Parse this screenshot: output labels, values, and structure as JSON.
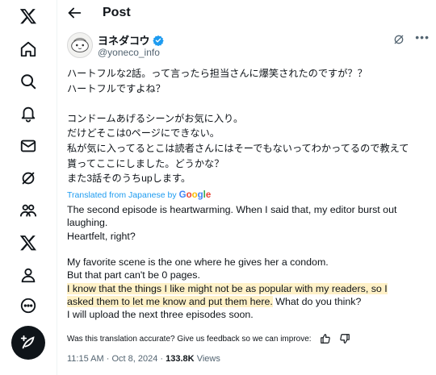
{
  "header": {
    "title": "Post"
  },
  "author": {
    "display_name": "ヨネダコウ",
    "handle": "@yoneco_info",
    "verified": true
  },
  "post": {
    "original_lines": [
      "ハートフルな2話。って言ったら担当さんに爆笑されたのですが？？",
      "ハートフルですよね？",
      "",
      "コンドームあげるシーンがお気に入り。",
      "だけどそこは0ページにできない。",
      "私が気に入ってるとこは読者さんにはそーでもないってわかってるので教えて",
      "貰ってここにしました。どうかな？",
      "また3話そのうちupします。"
    ],
    "translated_label": "Translated from Japanese by",
    "translation_provider": "Google",
    "translation_lines": [
      "The second episode is heartwarming. When I said that, my editor burst out",
      "laughing.",
      "Heartfelt, right?",
      "",
      "My favorite scene is the one where he gives her a condom.",
      "But that part can't be 0 pages."
    ],
    "highlight_line_1": "I know that the things I like might not be as popular with my readers, so I",
    "highlight_line_2": "asked them to let me know and put them here.",
    "after_highlight": " What do you think?",
    "final_line": "I will upload the next three episodes soon.",
    "feedback_prompt": "Was this translation accurate? Give us feedback so we can improve:",
    "time": "11:15 AM",
    "date": "Oct 8, 2024",
    "views_count": "133.8K",
    "views_label": "Views",
    "separator": "·"
  },
  "colors": {
    "accent": "#1d9bf0",
    "highlight": "#fff1c7",
    "text": "#0f1419",
    "muted": "#536471"
  },
  "nav_icons": [
    "x-logo-icon",
    "home-icon",
    "search-icon",
    "notifications-icon",
    "messages-icon",
    "grok-icon",
    "communities-icon",
    "premium-x-icon",
    "profile-icon",
    "more-icon",
    "compose-icon"
  ]
}
